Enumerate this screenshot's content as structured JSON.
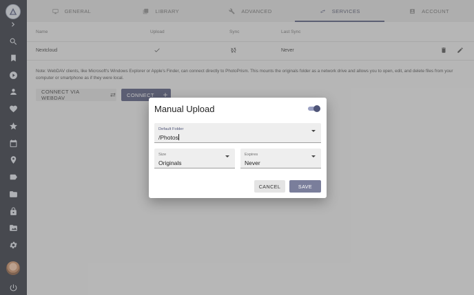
{
  "tabs": [
    {
      "label": "GENERAL",
      "icon": "monitor-icon"
    },
    {
      "label": "LIBRARY",
      "icon": "library-icon"
    },
    {
      "label": "ADVANCED",
      "icon": "wrench-icon"
    },
    {
      "label": "SERVICES",
      "icon": "sync-arrows-icon",
      "active": true
    },
    {
      "label": "ACCOUNT",
      "icon": "account-box-icon"
    }
  ],
  "table": {
    "headers": [
      "Name",
      "Upload",
      "Sync",
      "Last Sync"
    ],
    "rows": [
      {
        "name": "Nextcloud",
        "upload": "check-icon",
        "sync": "sync-off-icon",
        "last_sync": "Never"
      }
    ]
  },
  "note": "Note: WebDAV clients, like Microsoft's Windows Explorer or Apple's Finder, can connect directly to PhotoPrism. This mounts the originals folder as a network drive and allows you to open, edit, and delete files from your computer or smartphone as if they were local.",
  "buttons": {
    "webdav": "CONNECT VIA WEBDAV",
    "connect": "CONNECT"
  },
  "dialog": {
    "title": "Manual Upload",
    "toggle_enabled": true,
    "default_folder": {
      "label": "Default Folder",
      "value": "/Photos"
    },
    "size": {
      "label": "Size",
      "value": "Originals"
    },
    "expires": {
      "label": "Expires",
      "value": "Never"
    },
    "cancel": "CANCEL",
    "save": "SAVE"
  },
  "colors": {
    "sidebar": "#2b2f3a",
    "accent": "#4f5578",
    "save_button": "#7a7e9b"
  }
}
